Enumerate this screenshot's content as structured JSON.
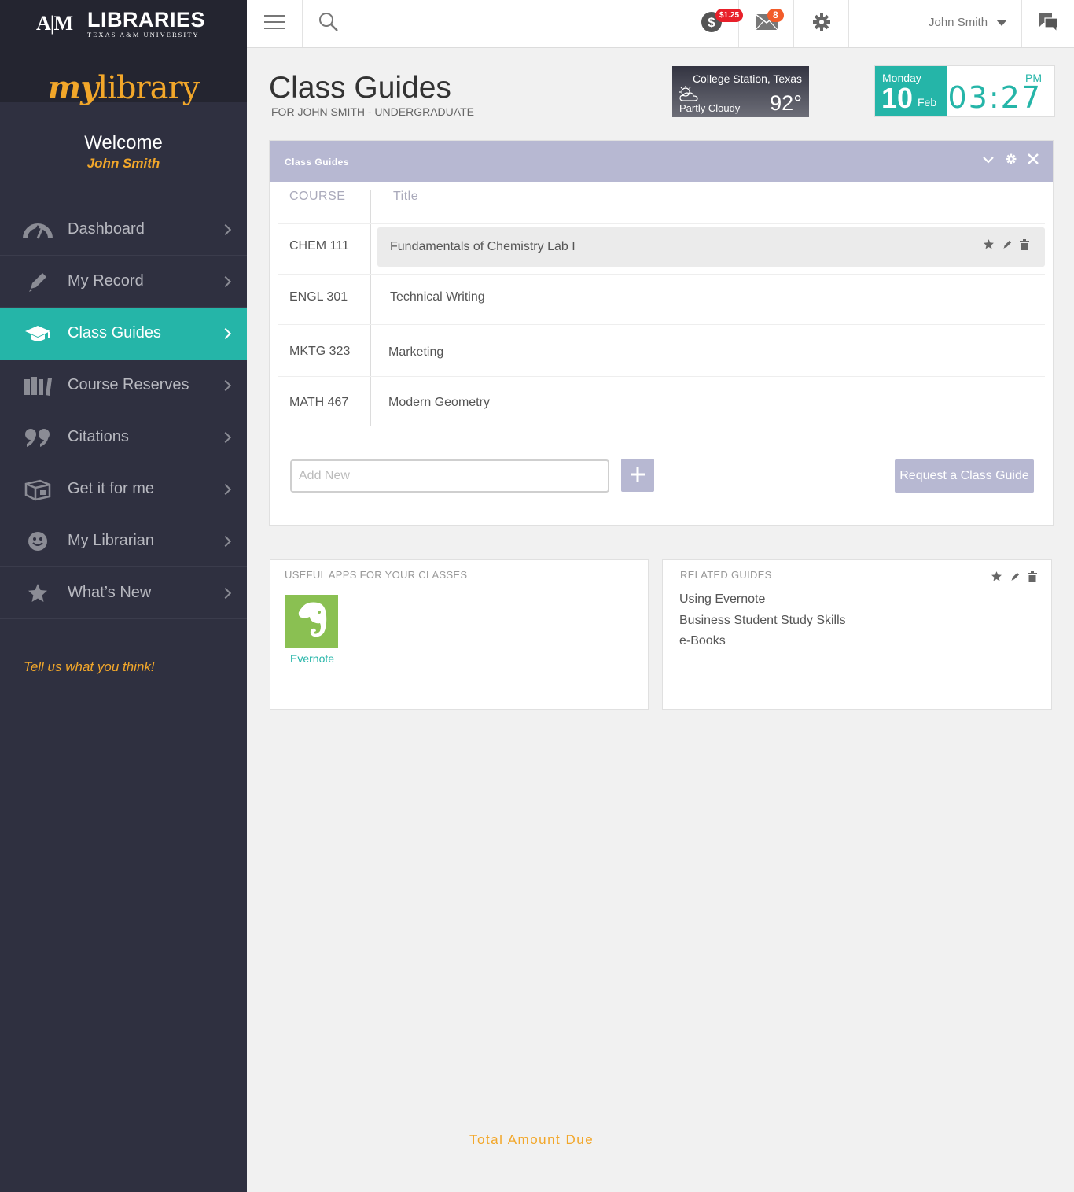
{
  "brand": {
    "mark": "A|M",
    "name": "LIBRARIES",
    "subtitle": "TEXAS A&M UNIVERSITY",
    "app_my": "my",
    "app_library": "library"
  },
  "welcome": {
    "title": "Welcome",
    "name": "John Smith"
  },
  "sidebar": {
    "items": [
      {
        "label": "Dashboard",
        "icon": "gauge-icon",
        "active": false
      },
      {
        "label": "My Record",
        "icon": "pencil-icon",
        "active": false
      },
      {
        "label": "Class Guides",
        "icon": "graduation-cap-icon",
        "active": true
      },
      {
        "label": "Course Reserves",
        "icon": "books-icon",
        "active": false
      },
      {
        "label": "Citations",
        "icon": "quote-icon",
        "active": false
      },
      {
        "label": "Get it for me",
        "icon": "package-icon",
        "active": false
      },
      {
        "label": "My Librarian",
        "icon": "smiley-icon",
        "active": false
      },
      {
        "label": "What’s New",
        "icon": "star-icon",
        "active": false
      }
    ],
    "feedback": "Tell us what you think!"
  },
  "topbar": {
    "fines_badge": "$1.25",
    "mail_badge": "8",
    "user_name": "John Smith",
    "colors": {
      "fines": "#e8202a",
      "mail": "#f25c2a"
    }
  },
  "page": {
    "title": "Class Guides",
    "subtitle": "FOR JOHN SMITH - UNDERGRADUATE"
  },
  "weather": {
    "city": "College Station, Texas",
    "condition": "Partly Cloudy",
    "temp": "92°"
  },
  "clock": {
    "day": "Monday",
    "date": "10",
    "month": "Feb",
    "ampm": "PM",
    "time": "03:27"
  },
  "panel": {
    "title": "Class Guides",
    "columns": {
      "course": "COURSE",
      "title": "Title"
    },
    "rows": [
      {
        "course": "CHEM 111",
        "title": "Fundamentals of Chemistry Lab I",
        "highlighted": true
      },
      {
        "course": "ENGL 301",
        "title": "Technical Writing",
        "highlighted": false
      },
      {
        "course": "MKTG 323",
        "title": "Marketing",
        "highlighted": false
      },
      {
        "course": "MATH 467",
        "title": "Modern Geometry",
        "highlighted": false
      }
    ],
    "add_placeholder": "Add New",
    "add_value": "",
    "request_label": "Request a Class Guide"
  },
  "apps_card": {
    "title": "USEFUL APPS FOR YOUR CLASSES",
    "apps": [
      {
        "label": "Evernote",
        "icon": "evernote-elephant-icon",
        "color": "#8ac052"
      }
    ]
  },
  "related_card": {
    "title": "RELATED GUIDES",
    "guides": [
      "Using Evernote",
      "Business Student Study Skills",
      "e-Books"
    ]
  },
  "footer": {
    "total_due": "Total Amount Due"
  },
  "colors": {
    "accent": "#25b5a8",
    "highlight": "#f2a72a",
    "panel_header": "#b7b8d2",
    "sidebar_bg": "#2f3040"
  }
}
